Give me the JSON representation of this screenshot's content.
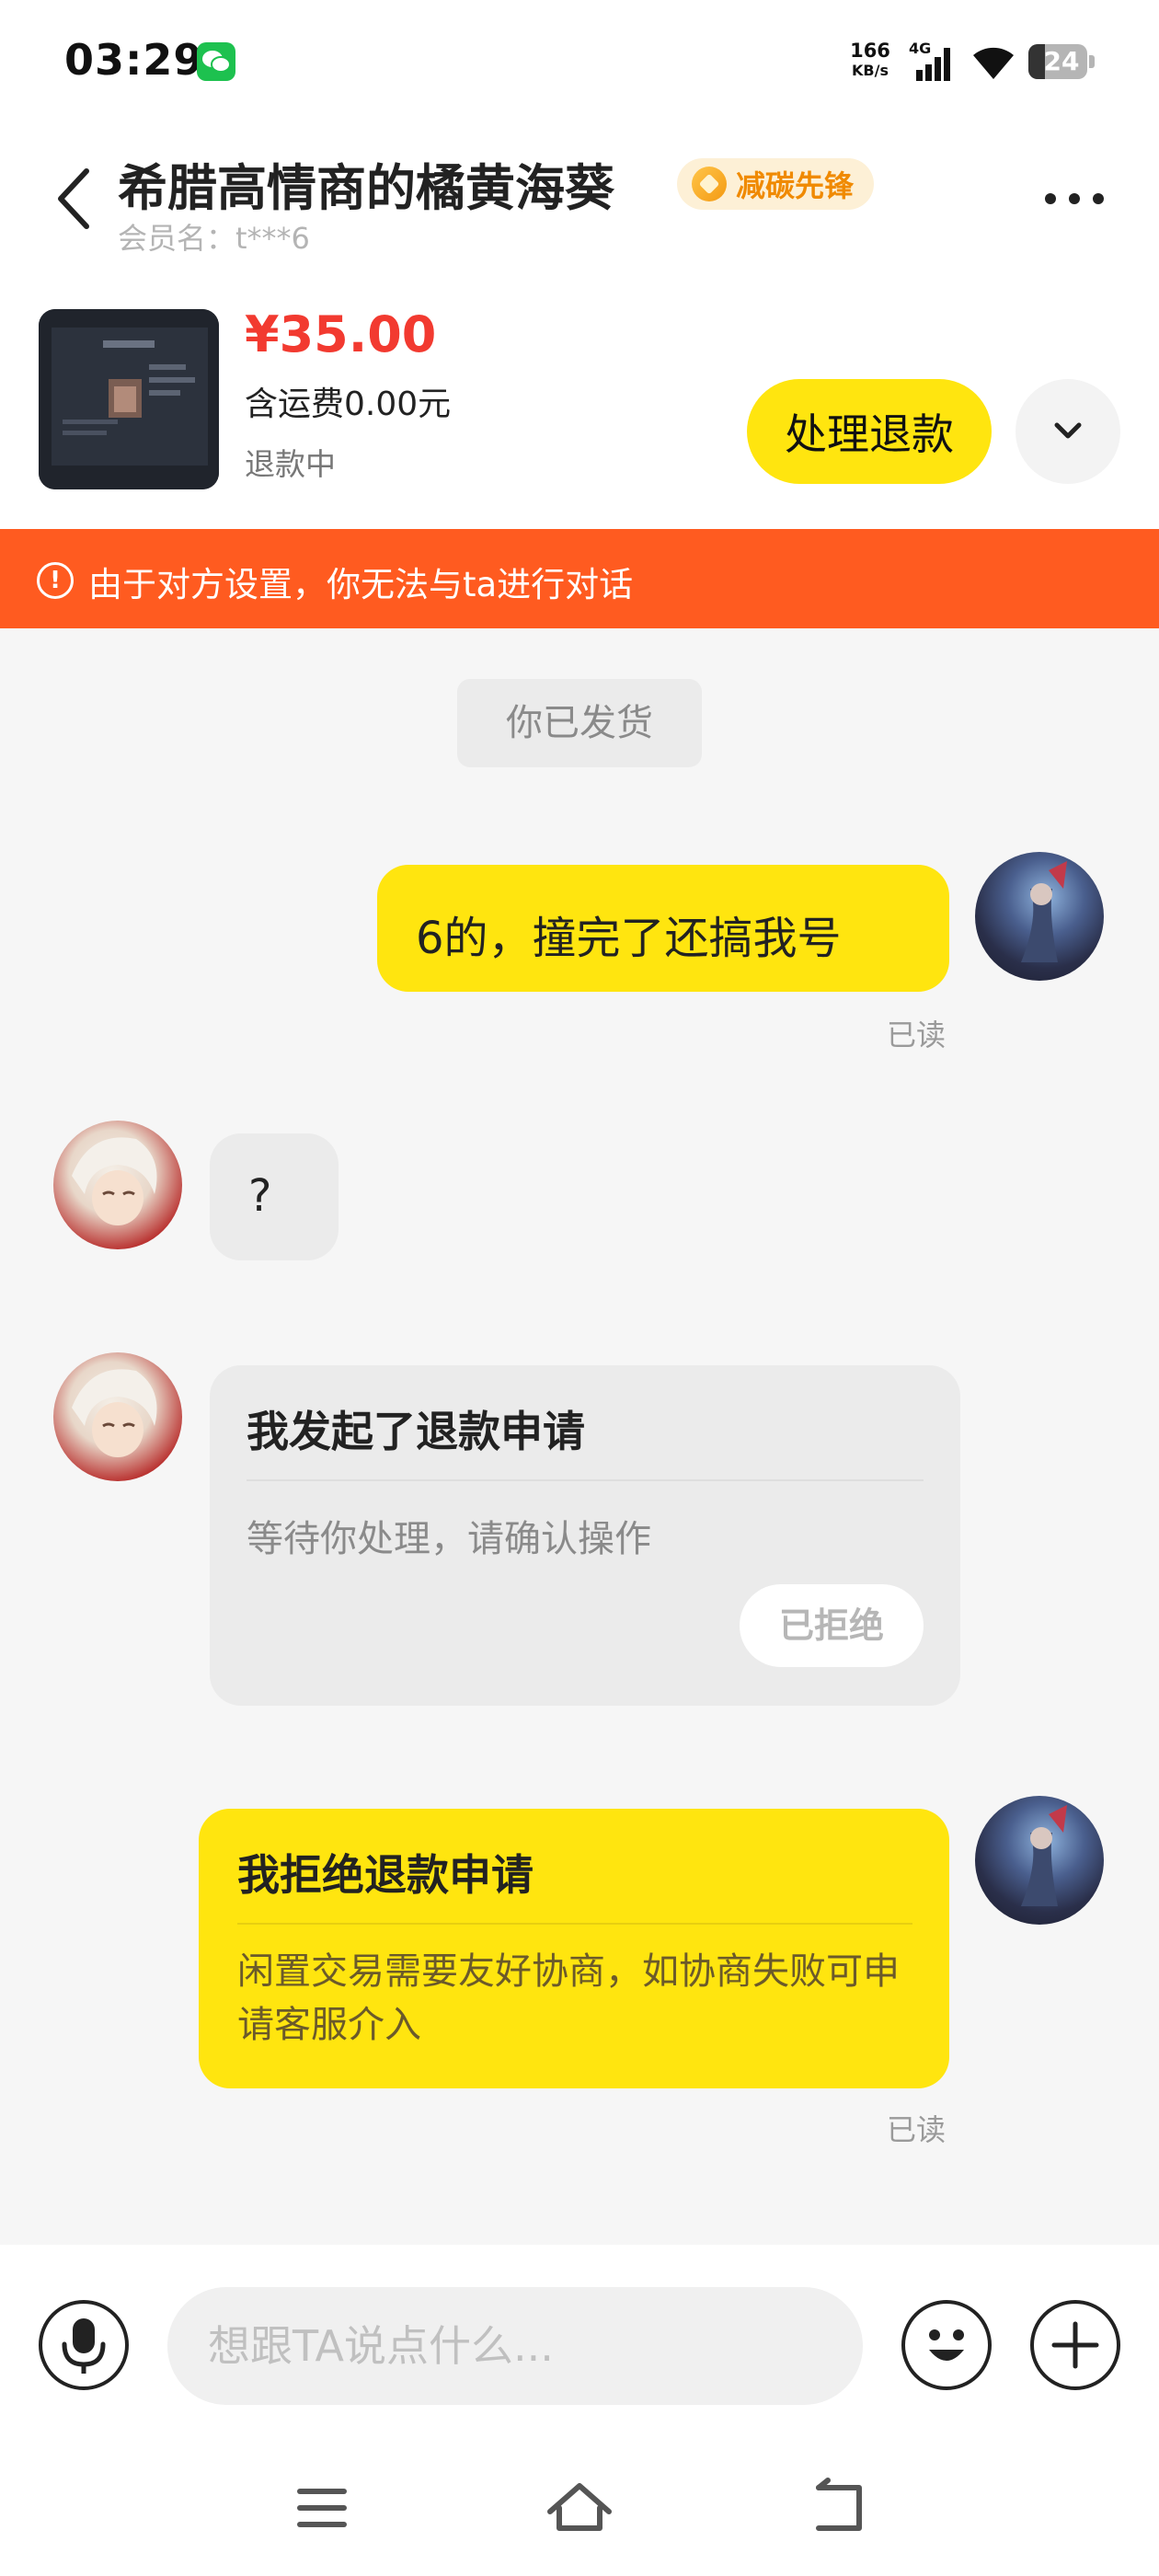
{
  "status_bar": {
    "time": "03:29",
    "net_speed_value": "166",
    "net_speed_unit": "KB/s",
    "network_type": "4G",
    "battery": "24"
  },
  "header": {
    "contact_name": "希腊高情商的橘黄海葵",
    "badge_label": "减碳先锋",
    "member_label": "会员名：t***6"
  },
  "product": {
    "price": "¥35.00",
    "shipping": "含运费0.00元",
    "status": "退款中",
    "action_button": "处理退款"
  },
  "banner": {
    "icon": "!",
    "text": "由于对方设置，你无法与ta进行对话"
  },
  "messages": {
    "system_notice": "你已发货",
    "msg1_text": "6的，撞完了还搞我号",
    "msg1_read": "已读",
    "msg2_text": "?",
    "refund_request": {
      "title": "我发起了退款申请",
      "desc": "等待你处理，请确认操作",
      "chip": "已拒绝"
    },
    "refund_reject": {
      "title": "我拒绝退款申请",
      "desc": "闲置交易需要友好协商，如协商失败可申请客服介入",
      "read": "已读"
    }
  },
  "input": {
    "placeholder": "想跟TA说点什么..."
  },
  "icons": {
    "back": "chevron-left-icon",
    "more": "more-dots-icon",
    "expand": "chevron-down-icon",
    "voice": "microphone-icon",
    "emoji": "smiley-icon",
    "add": "plus-icon",
    "nav_menu": "menu-icon",
    "nav_home": "home-icon",
    "nav_back": "return-icon"
  },
  "colors": {
    "accent_yellow": "#ffe50f",
    "banner_orange": "#ff5b20",
    "price_red": "#f23a30",
    "badge_orange": "#f08a00"
  }
}
